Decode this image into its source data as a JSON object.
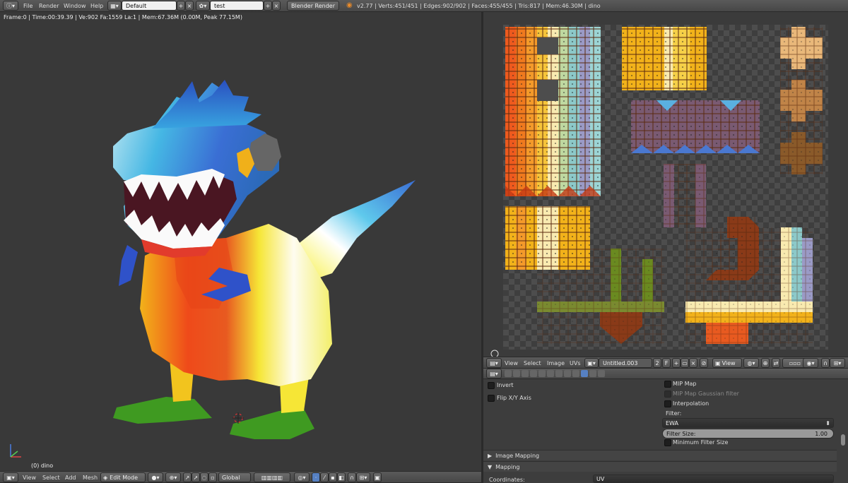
{
  "topbar": {
    "menus": [
      "File",
      "Render",
      "Window",
      "Help"
    ],
    "layout_value": "Default",
    "scene_value": "test",
    "engine_value": "Blender Render",
    "stats": "v2.77 | Verts:451/451 | Edges:902/902 | Faces:455/455 | Tris:817 | Mem:46.30M | dino"
  },
  "viewport3d": {
    "info": "Frame:0 | Time:00:39.39 | Ve:902 Fa:1559 La:1 | Mem:67.36M (0.00M, Peak 77.15M)",
    "object_label": "(0) dino",
    "menus": [
      "View",
      "Select",
      "Add",
      "Mesh"
    ],
    "mode": "Edit Mode",
    "orientation": "Global"
  },
  "uv_editor": {
    "menus": [
      "View",
      "Select",
      "Image",
      "UVs"
    ],
    "image_name": "Untitled.003",
    "users_count": "2",
    "fake_user": "F",
    "view_menu": "View"
  },
  "properties": {
    "invert_label": "Invert",
    "flip_label": "Flip X/Y Axis",
    "mipmap_label": "MIP Map",
    "mipmap_gauss_label": "MIP Map Gaussian filter",
    "interpolation_label": "Interpolation",
    "filter_label": "Filter:",
    "filter_value": "EWA",
    "filter_size_label": "Filter Size:",
    "filter_size_value": "1.00",
    "min_filter_label": "Minimum Filter Size",
    "image_mapping_label": "Image Mapping",
    "mapping_label": "Mapping",
    "coordinates_label": "Coordinates:",
    "coordinates_value": "UV"
  },
  "colors": {
    "header": "#4f4f4f",
    "viewport_bg": "#393939",
    "accent_blue": "#5680c2"
  }
}
